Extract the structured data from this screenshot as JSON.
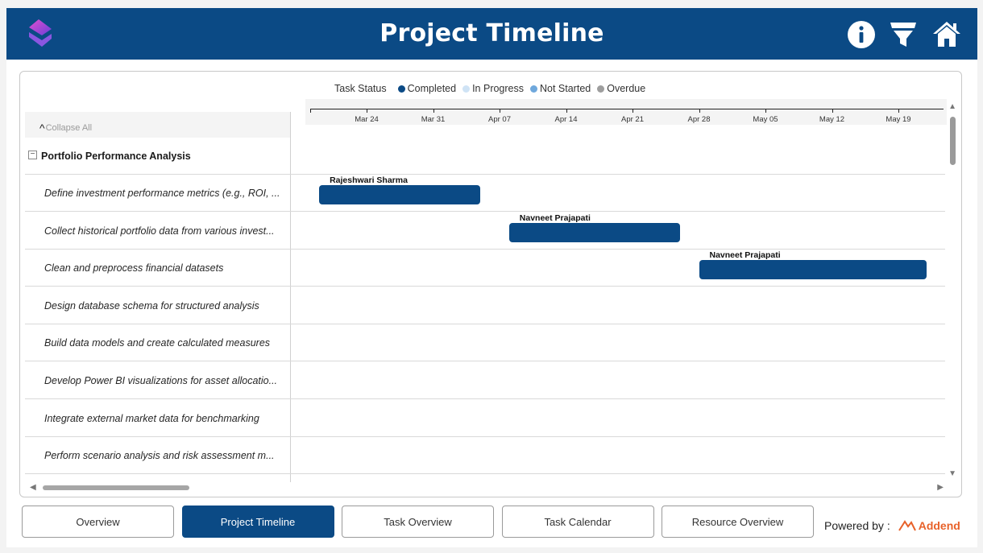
{
  "header": {
    "title": "Project Timeline",
    "icons": [
      "info-icon",
      "filter-icon",
      "home-icon"
    ],
    "bg_color": "#0b4a85"
  },
  "legend": {
    "title": "Task Status",
    "items": [
      {
        "label": "Completed",
        "color": "#0b4a85"
      },
      {
        "label": "In Progress",
        "color": "#cfe3f5"
      },
      {
        "label": "Not Started",
        "color": "#6fa8dc"
      },
      {
        "label": "Overdue",
        "color": "#9e9e9e"
      }
    ]
  },
  "collapse_label": "Collapse All",
  "timeline": {
    "dates": [
      "Mar 24",
      "Mar 31",
      "Apr 07",
      "Apr 14",
      "Apr 21",
      "Apr 28",
      "May 05",
      "May 12",
      "May 19"
    ]
  },
  "group": {
    "label": "Portfolio Performance Analysis"
  },
  "tasks": [
    {
      "label": "Define investment performance metrics (e.g., ROI, ...",
      "assignee": "Rajeshwari Sharma",
      "start": "Mar 19",
      "end": "Apr 05",
      "status": "Completed"
    },
    {
      "label": "Collect historical portfolio data from various invest...",
      "assignee": "Navneet Prajapati",
      "start": "Apr 08",
      "end": "Apr 26",
      "status": "Completed"
    },
    {
      "label": "Clean and preprocess financial datasets",
      "assignee": "Navneet Prajapati",
      "start": "Apr 28",
      "end": "May 22",
      "status": "Completed"
    },
    {
      "label": "Design database schema for structured analysis"
    },
    {
      "label": "Build data models and create calculated measures"
    },
    {
      "label": "Develop Power BI visualizations for asset allocatio..."
    },
    {
      "label": "Integrate external market data for benchmarking"
    },
    {
      "label": "Perform scenario analysis and risk assessment m..."
    }
  ],
  "tabs": [
    {
      "label": "Overview",
      "active": false
    },
    {
      "label": "Project Timeline",
      "active": true
    },
    {
      "label": "Task Overview",
      "active": false
    },
    {
      "label": "Task Calendar",
      "active": false
    },
    {
      "label": "Resource Overview",
      "active": false
    }
  ],
  "footer": {
    "powered_label": "Powered by :",
    "brand": "Addend",
    "brand_color": "#e8622a"
  }
}
